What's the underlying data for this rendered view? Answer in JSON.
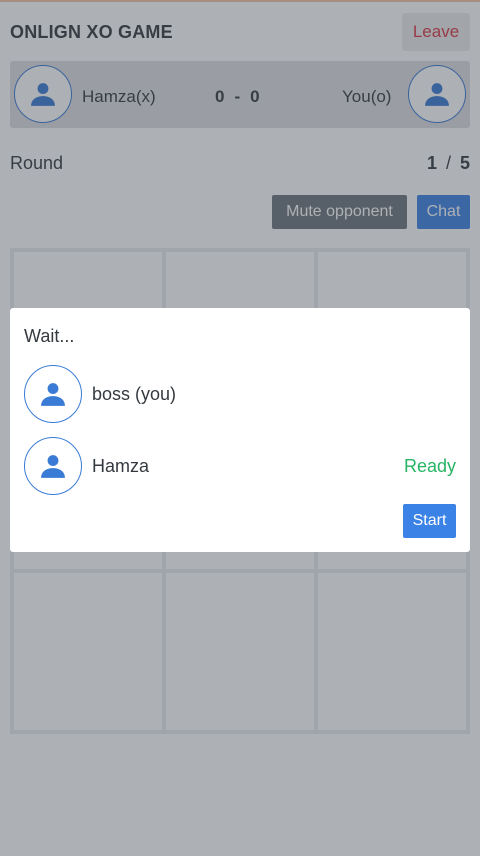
{
  "header": {
    "title": "ONLIGN XO GAME",
    "leave_label": "Leave"
  },
  "scoreboard": {
    "player1": {
      "name": "Hamza(x)",
      "avatar_icon": "user-icon"
    },
    "player2": {
      "name": "You(o)",
      "avatar_icon": "user-icon"
    },
    "score1": "0",
    "separator": "-",
    "score2": "0"
  },
  "round": {
    "label": "Round",
    "current": "1",
    "separator": "/",
    "total": "5"
  },
  "controls": {
    "mute_label": "Mute opponent",
    "chat_label": "Chat"
  },
  "board": {
    "cells": [
      "",
      "",
      "",
      "",
      "",
      "",
      "",
      "",
      ""
    ]
  },
  "modal": {
    "title": "Wait...",
    "players": [
      {
        "name": "boss (you)",
        "status": ""
      },
      {
        "name": "Hamza",
        "status": "Ready"
      }
    ],
    "start_label": "Start"
  },
  "colors": {
    "accent": "#3b82e6",
    "danger": "#dc3545",
    "success": "#28b463",
    "secondary": "#6c757d"
  }
}
